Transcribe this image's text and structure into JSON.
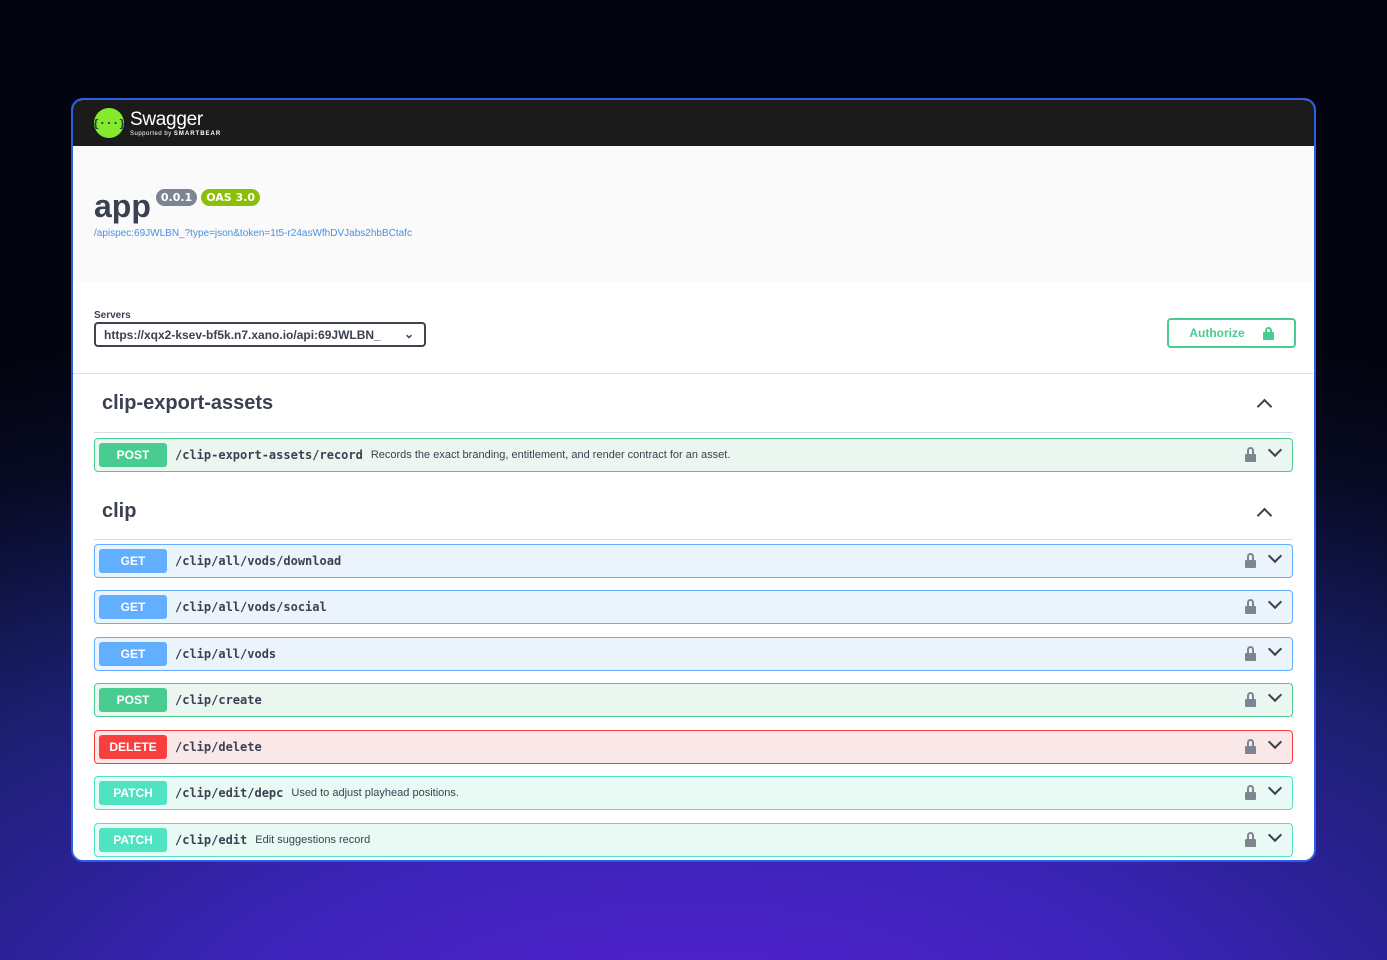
{
  "header": {
    "logo_glyph": "{···}",
    "logo_name": "Swagger",
    "logo_sub_prefix": "Supported by",
    "logo_sub_brand": "SMARTBEAR"
  },
  "info": {
    "title": "app",
    "version": "0.0.1",
    "oas": "OAS 3.0",
    "spec_url": "/apispec:69JWLBN_?type=json&token=1t5-r24asWfhDVJabs2hbBCtafc"
  },
  "servers": {
    "label": "Servers",
    "selected": "https://xqx2-ksev-bf5k.n7.xano.io/api:69JWLBN_"
  },
  "authorize_label": "Authorize",
  "tags": [
    {
      "name": "clip-export-assets",
      "operations": [
        {
          "method": "POST",
          "path": "/clip-export-assets/record",
          "summary": "Records the exact branding, entitlement, and render contract for an asset."
        }
      ]
    },
    {
      "name": "clip",
      "operations": [
        {
          "method": "GET",
          "path": "/clip/all/vods/download",
          "summary": ""
        },
        {
          "method": "GET",
          "path": "/clip/all/vods/social",
          "summary": ""
        },
        {
          "method": "GET",
          "path": "/clip/all/vods",
          "summary": ""
        },
        {
          "method": "POST",
          "path": "/clip/create",
          "summary": ""
        },
        {
          "method": "DELETE",
          "path": "/clip/delete",
          "summary": ""
        },
        {
          "method": "PATCH",
          "path": "/clip/edit/depc",
          "summary": "Used to adjust playhead positions."
        },
        {
          "method": "PATCH",
          "path": "/clip/edit",
          "summary": "Edit suggestions record"
        }
      ]
    }
  ],
  "colors": {
    "post": "#49cc90",
    "get": "#61affe",
    "delete": "#f93e3e",
    "patch": "#50e3c2",
    "frame_border": "#2b5fe8"
  }
}
